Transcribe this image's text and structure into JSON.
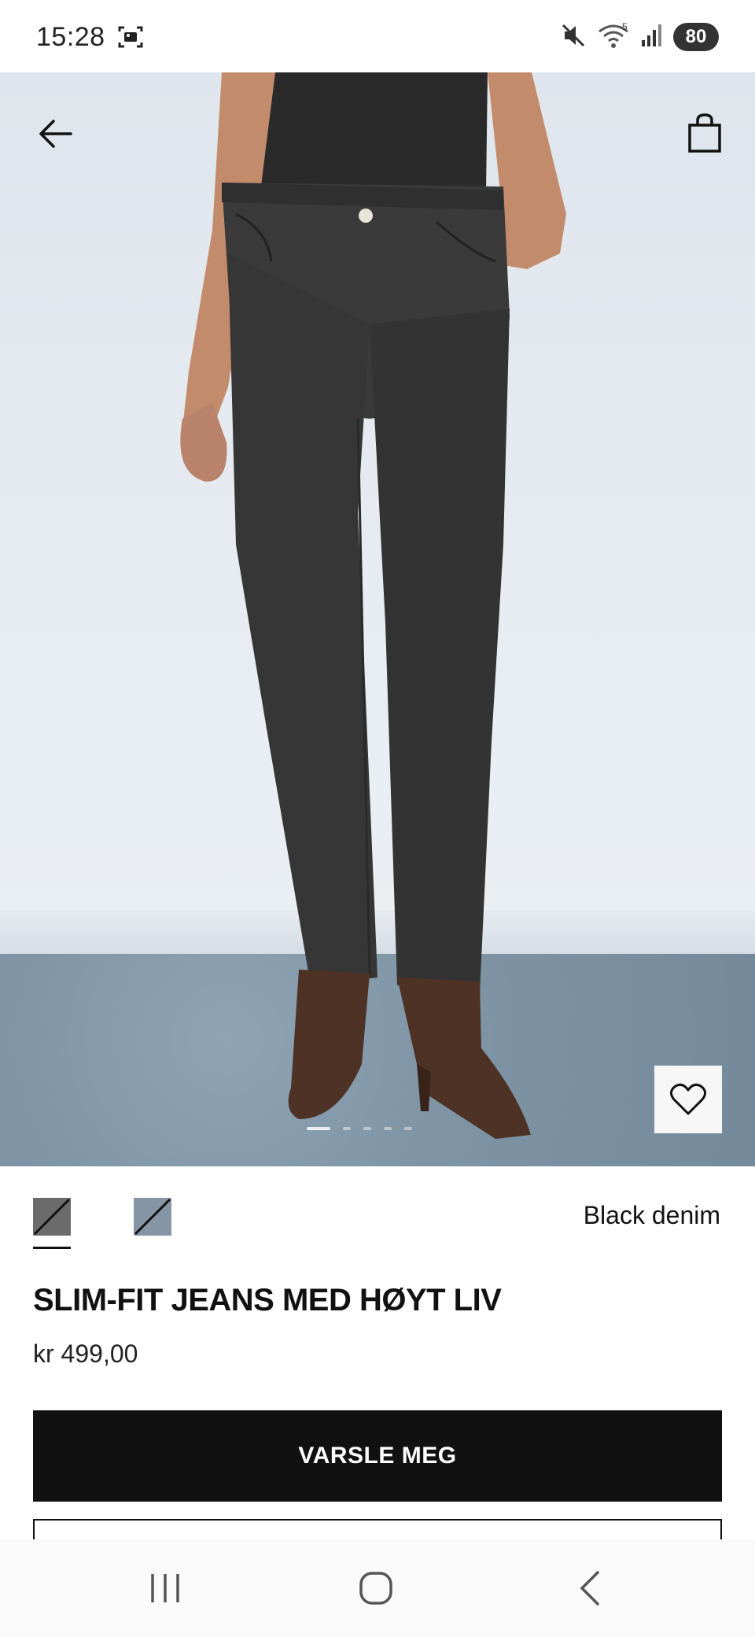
{
  "status_bar": {
    "time": "15:28",
    "battery": "80",
    "icons": [
      "screenshot-icon",
      "mute-icon",
      "wifi-icon",
      "signal-icon"
    ]
  },
  "header": {
    "back_icon": "arrow-left-icon",
    "bag_icon": "shopping-bag-icon"
  },
  "gallery": {
    "favorite_icon": "heart-icon",
    "dots": 5,
    "active_dot": 0
  },
  "product": {
    "color_name": "Black denim",
    "swatches": [
      "black-denim",
      "blue-grey-denim"
    ],
    "title": "SLIM-FIT JEANS MED HØYT LIV",
    "price": "kr 499,00",
    "notify_label": "VARSLE MEG"
  },
  "colors": {
    "primary": "#111111",
    "background": "#ffffff"
  },
  "nav_bar": {
    "recent_icon": "recent-apps-icon",
    "home_icon": "home-icon",
    "back_icon": "back-icon"
  }
}
